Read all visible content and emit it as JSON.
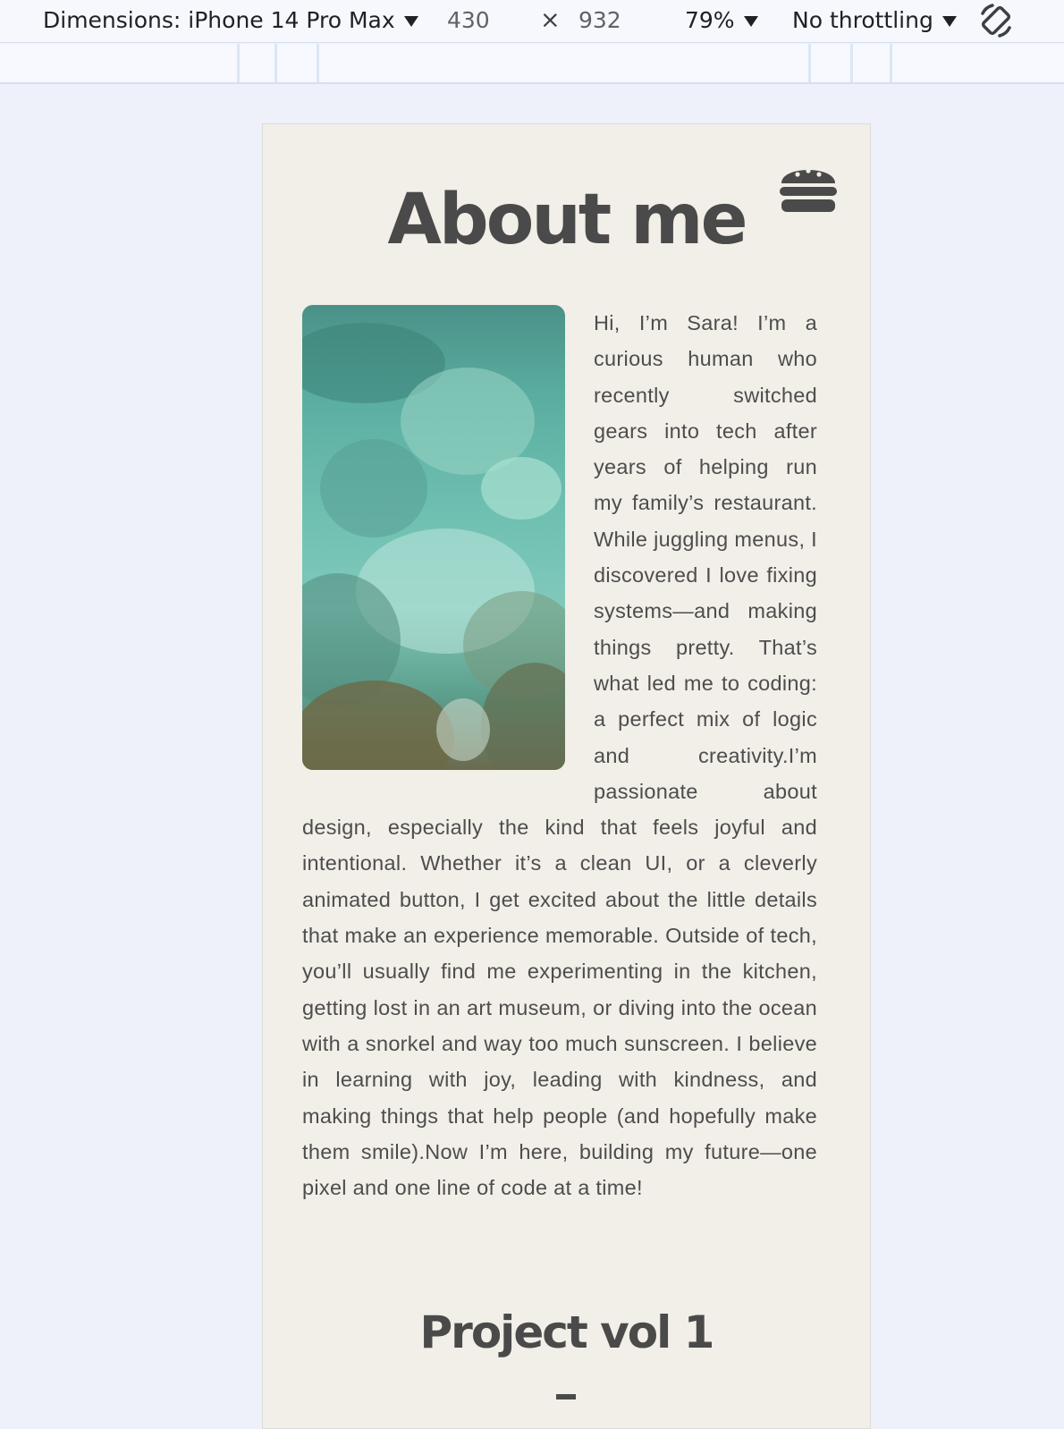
{
  "devtools": {
    "device_label": "Dimensions: iPhone 14 Pro Max",
    "width_value": "430",
    "times_symbol": "×",
    "height_value": "932",
    "zoom_label": "79%",
    "throttle_label": "No throttling",
    "icons": {
      "device_dropdown": "chevron-down-icon",
      "rotate": "rotate-icon"
    }
  },
  "page": {
    "menu_icon": "hamburger-icon",
    "title": "About me",
    "photo_icon": "underwater-coral-photo",
    "about_paragraph": "Hi, I’m Sara! I’m a curious human who recently switched gears into tech after years of helping run my family’s restaurant. While juggling menus, I discovered I love fixing systems—and making things pretty. That’s what led me to coding: a perfect mix of logic and creativity.I’m passionate about design, especially the kind that feels joyful and intentional. Whether it’s a clean UI, or a cleverly animated button, I get excited about the little details that make an experience memorable. Outside of tech, you’ll usually find me experimenting in the kitchen, getting lost in an art museum, or diving into the ocean with a snorkel and way too much sunscreen. I believe in learning with joy, leading with kindness, and making things that help people (and hopefully make them smile).Now I’m here, building my future—one pixel and one line of code at a time!",
    "next_section_title": "Project vol 1"
  },
  "colors": {
    "page_background": "#f2efe8",
    "heading": "#4a4a4a",
    "body_text": "#4d4d4d",
    "devtools_background": "#f6f8fd"
  }
}
